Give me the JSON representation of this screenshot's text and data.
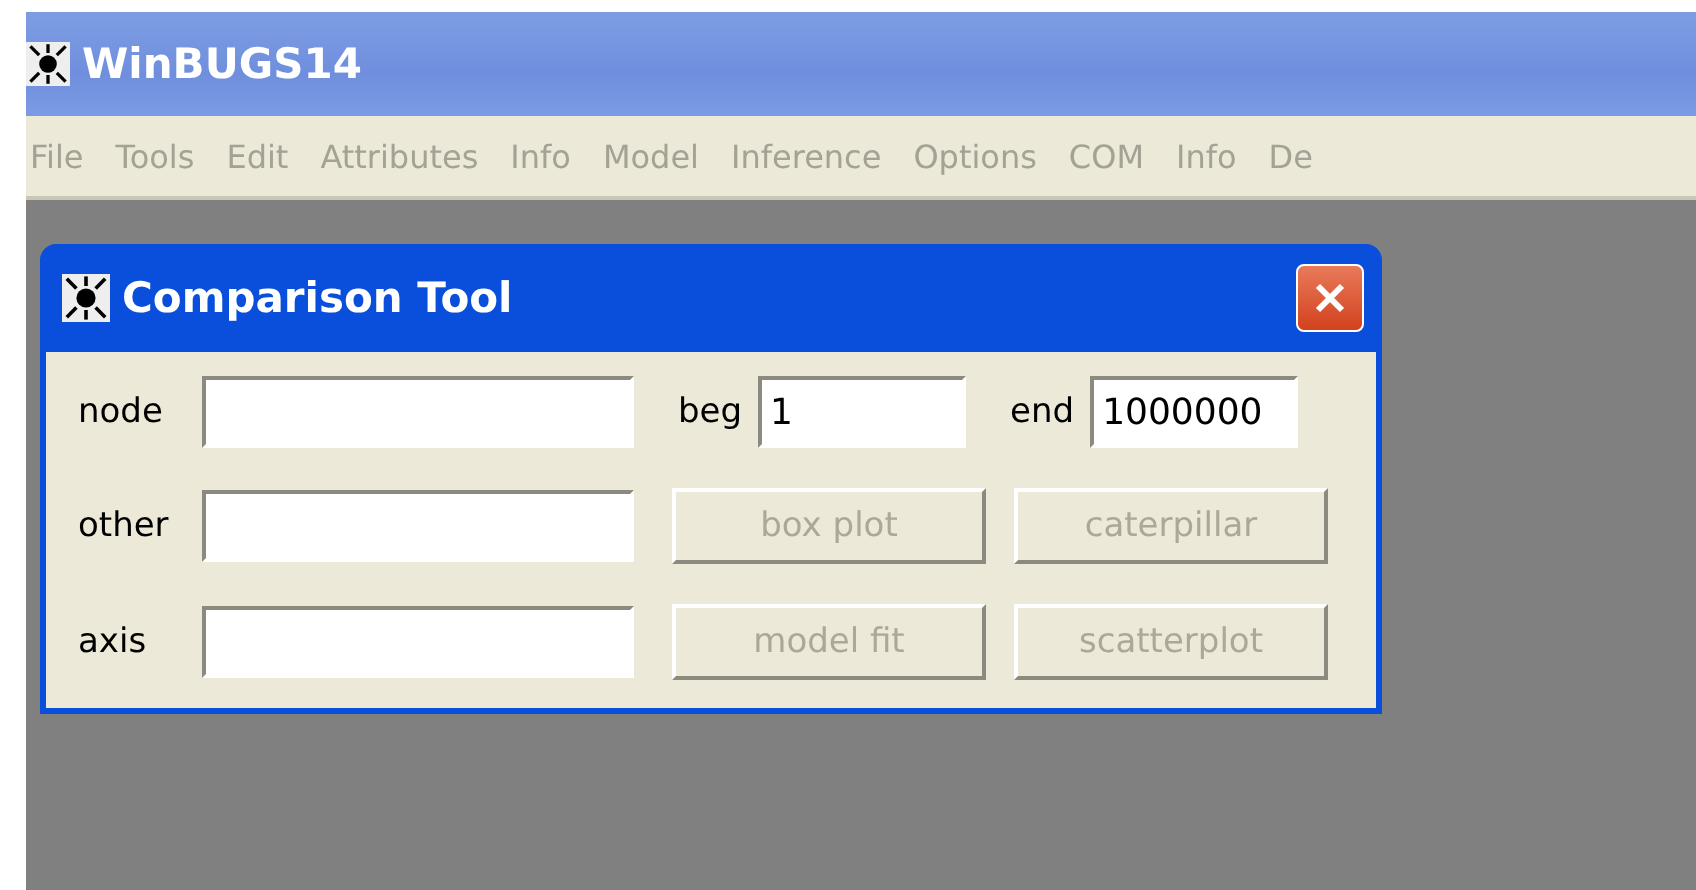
{
  "window": {
    "title": "WinBUGS14"
  },
  "menu": [
    "File",
    "Tools",
    "Edit",
    "Attributes",
    "Info",
    "Model",
    "Inference",
    "Options",
    "COM",
    "Info",
    "De"
  ],
  "dialog": {
    "title": "Comparison Tool",
    "fields": [
      {
        "label": "node"
      },
      {
        "label": "other"
      },
      {
        "label": "axis"
      }
    ],
    "range": [
      {
        "label": "beg",
        "value": "1"
      },
      {
        "label": "end",
        "value": "1000000"
      }
    ],
    "buttons": [
      {
        "label": "box plot",
        "disabled": true
      },
      {
        "label": "caterpillar",
        "disabled": true
      },
      {
        "label": "model fit",
        "disabled": true
      },
      {
        "label": "scatterplot",
        "disabled": true
      }
    ]
  }
}
